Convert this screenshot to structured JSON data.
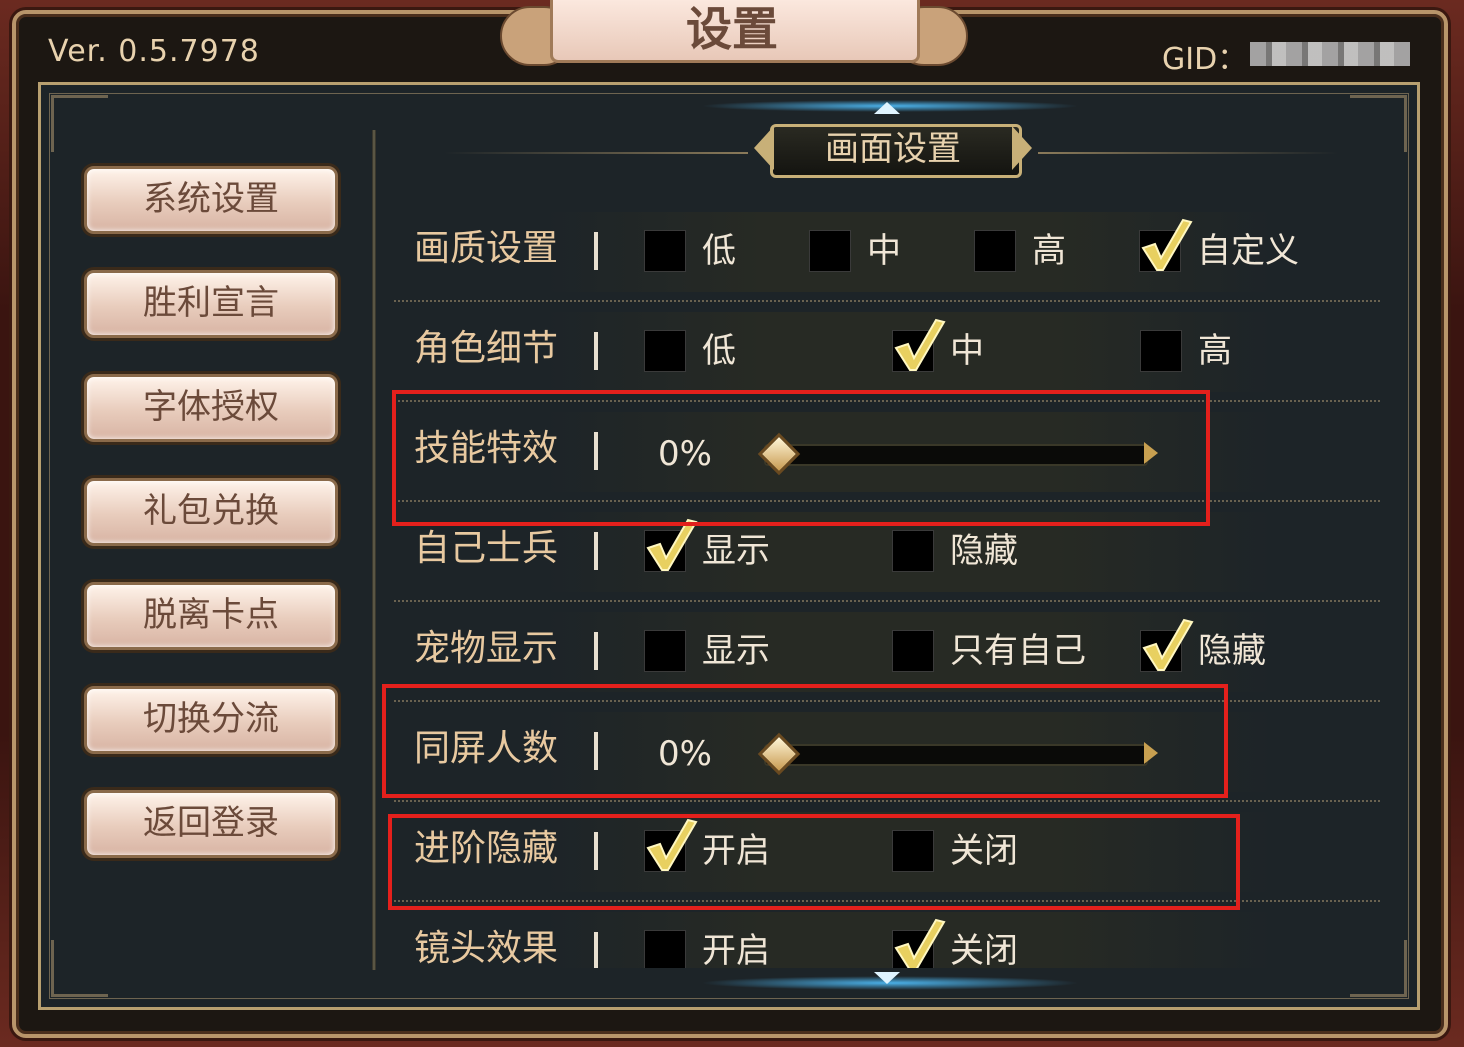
{
  "header": {
    "title": "设置",
    "version": "Ver. 0.5.7978",
    "gid_label": "GID："
  },
  "sidebar": {
    "items": [
      {
        "label": "系统设置"
      },
      {
        "label": "胜利宣言"
      },
      {
        "label": "字体授权"
      },
      {
        "label": "礼包兑换"
      },
      {
        "label": "脱离卡点"
      },
      {
        "label": "切换分流"
      },
      {
        "label": "返回登录"
      }
    ]
  },
  "section": {
    "title": "画面设置"
  },
  "settings": [
    {
      "label": "画质设置",
      "options": [
        {
          "text": "低",
          "checked": false
        },
        {
          "text": "中",
          "checked": false
        },
        {
          "text": "高",
          "checked": false
        },
        {
          "text": "自定义",
          "checked": true
        }
      ]
    },
    {
      "label": "角色细节",
      "options": [
        {
          "text": "低",
          "checked": false
        },
        {
          "text": "中",
          "checked": true
        },
        {
          "text": "高",
          "checked": false
        }
      ]
    },
    {
      "label": "技能特效",
      "slider_text": "0%",
      "slider_value": 0
    },
    {
      "label": "自己士兵",
      "options": [
        {
          "text": "显示",
          "checked": true
        },
        {
          "text": "隐藏",
          "checked": false
        }
      ]
    },
    {
      "label": "宠物显示",
      "options": [
        {
          "text": "显示",
          "checked": false
        },
        {
          "text": "只有自己",
          "checked": false
        },
        {
          "text": "隐藏",
          "checked": true
        }
      ]
    },
    {
      "label": "同屏人数",
      "slider_text": "0%",
      "slider_value": 0
    },
    {
      "label": "进阶隐藏",
      "options": [
        {
          "text": "开启",
          "checked": true
        },
        {
          "text": "关闭",
          "checked": false
        }
      ]
    },
    {
      "label": "镜头效果",
      "options": [
        {
          "text": "开启",
          "checked": false
        },
        {
          "text": "关闭",
          "checked": true
        }
      ]
    }
  ],
  "colors": {
    "highlight": "#e4201c",
    "checkmark": "#e8d060",
    "label": "#e8c9a0"
  }
}
